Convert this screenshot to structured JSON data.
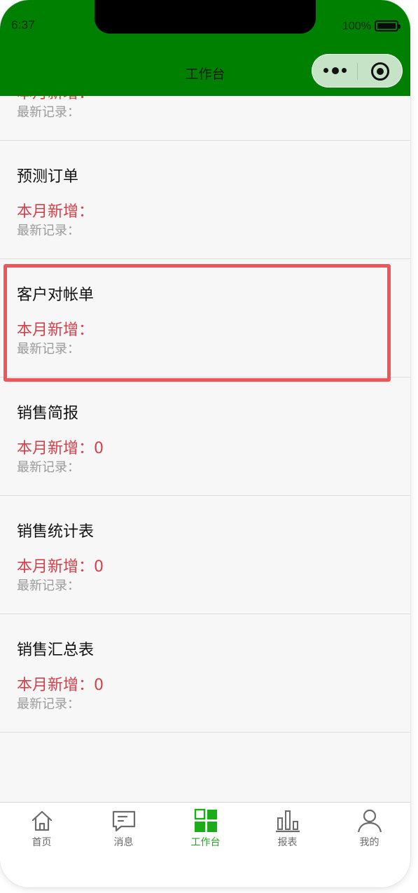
{
  "status_bar": {
    "time": "6:37",
    "battery": "100%"
  },
  "header": {
    "title": "工作台",
    "accent_color": "#008000",
    "capsule": {
      "more_icon": "more-dots-icon",
      "close_icon": "target-close-icon"
    }
  },
  "list": {
    "items": [
      {
        "title": "",
        "count_label": "本月新增：",
        "count_value": "",
        "latest_label": "最新记录："
      },
      {
        "title": "预测订单",
        "count_label": "本月新增：",
        "count_value": "",
        "latest_label": "最新记录："
      },
      {
        "title": "客户对帐单",
        "count_label": "本月新增：",
        "count_value": "",
        "latest_label": "最新记录："
      },
      {
        "title": "销售简报",
        "count_label": "本月新增：",
        "count_value": "0",
        "latest_label": "最新记录："
      },
      {
        "title": "销售统计表",
        "count_label": "本月新增：",
        "count_value": "0",
        "latest_label": "最新记录："
      },
      {
        "title": "销售汇总表",
        "count_label": "本月新增：",
        "count_value": "0",
        "latest_label": "最新记录："
      }
    ],
    "highlight_color": "#f0555a",
    "count_color": "#d4414b"
  },
  "tabbar": {
    "active_color": "#1aad19",
    "tabs": [
      {
        "label": "首页",
        "icon": "home-icon"
      },
      {
        "label": "消息",
        "icon": "message-icon"
      },
      {
        "label": "工作台",
        "icon": "workbench-icon",
        "active": true
      },
      {
        "label": "报表",
        "icon": "report-icon"
      },
      {
        "label": "我的",
        "icon": "profile-icon"
      }
    ]
  }
}
